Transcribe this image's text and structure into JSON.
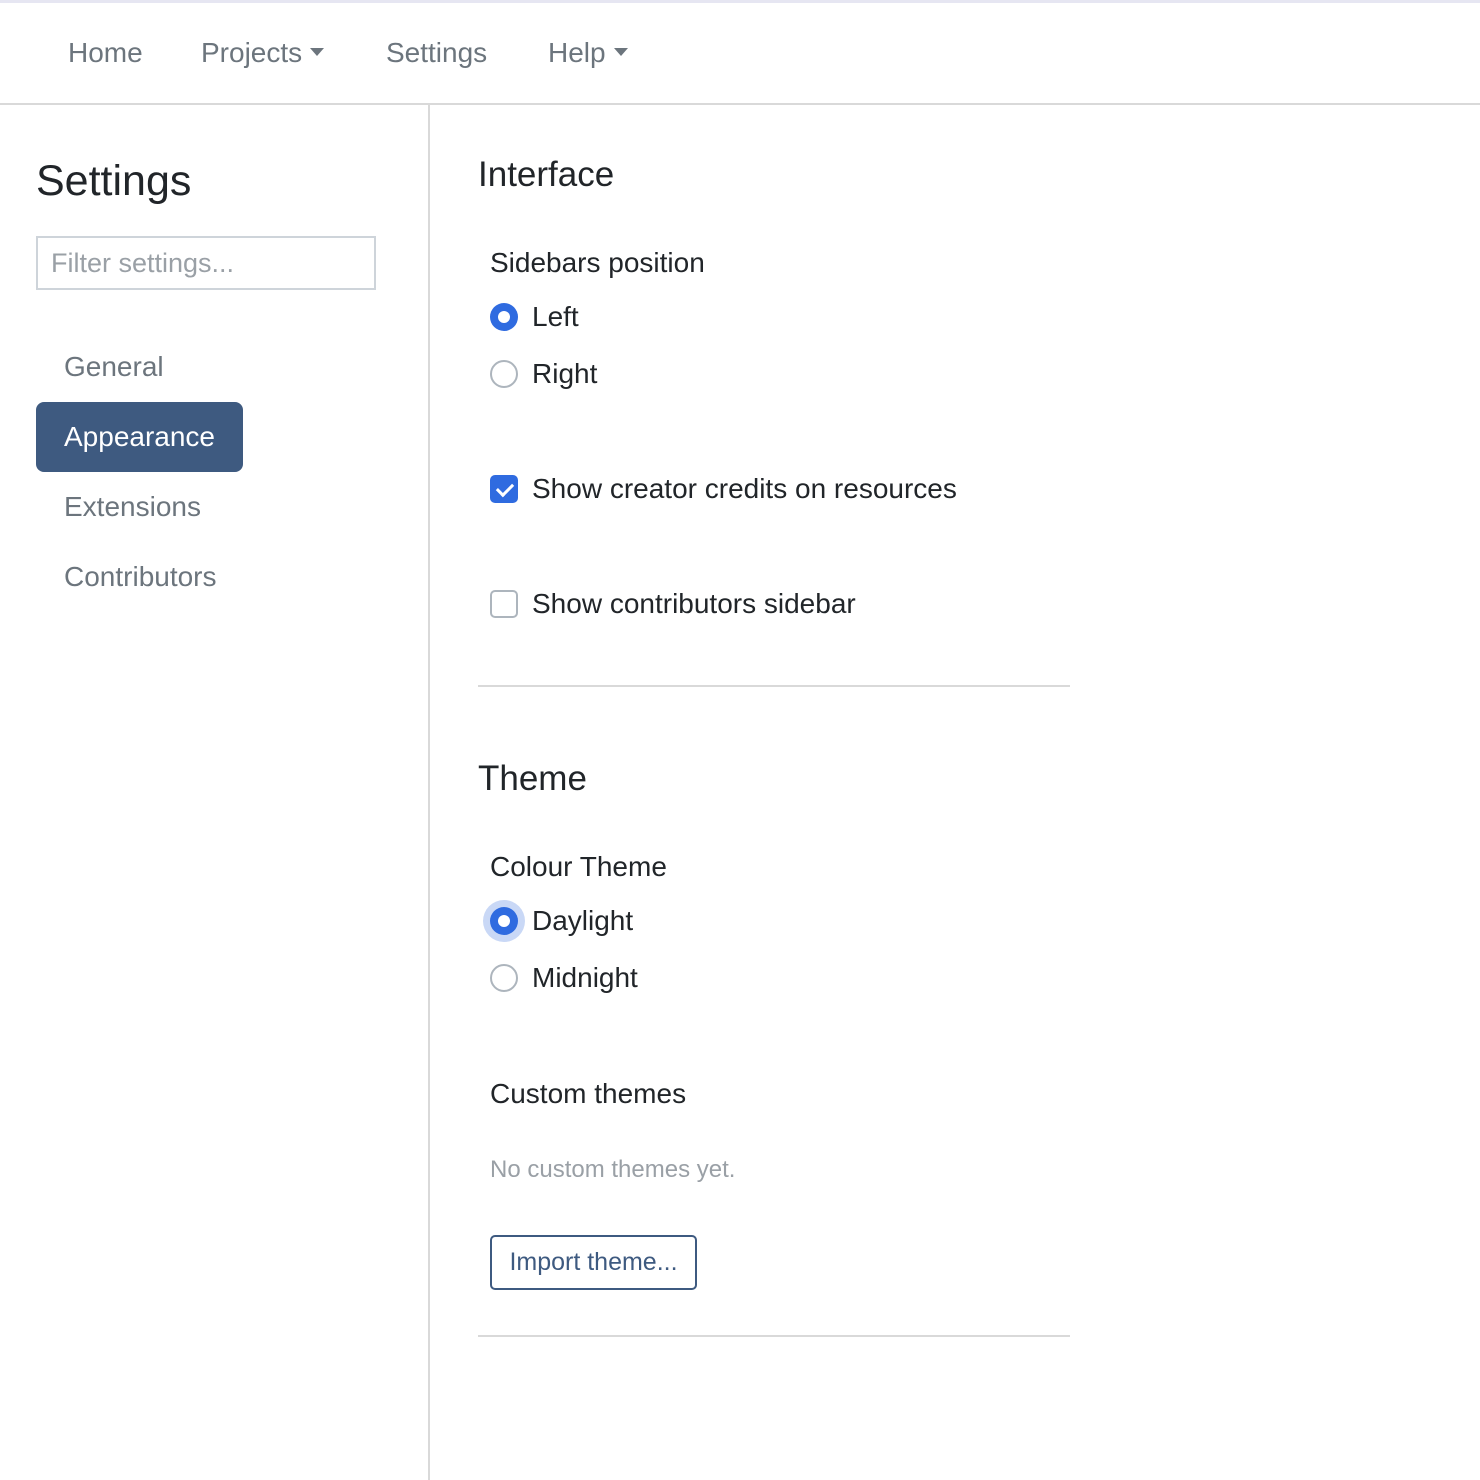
{
  "navbar": {
    "items": [
      {
        "label": "Home",
        "has_dropdown": false
      },
      {
        "label": "Projects",
        "has_dropdown": true
      },
      {
        "label": "Settings",
        "has_dropdown": false
      },
      {
        "label": "Help",
        "has_dropdown": true
      }
    ]
  },
  "sidebar": {
    "title": "Settings",
    "filter_placeholder": "Filter settings...",
    "items": [
      {
        "label": "General",
        "active": false
      },
      {
        "label": "Appearance",
        "active": true
      },
      {
        "label": "Extensions",
        "active": false
      },
      {
        "label": "Contributors",
        "active": false
      }
    ]
  },
  "interface": {
    "title": "Interface",
    "sidebars_position": {
      "label": "Sidebars position",
      "options": [
        {
          "label": "Left",
          "checked": true
        },
        {
          "label": "Right",
          "checked": false
        }
      ]
    },
    "show_creator_credits": {
      "label": "Show creator credits on resources",
      "checked": true
    },
    "show_contributors_sidebar": {
      "label": "Show contributors sidebar",
      "checked": false
    }
  },
  "theme": {
    "title": "Theme",
    "colour_theme": {
      "label": "Colour Theme",
      "options": [
        {
          "label": "Daylight",
          "checked": true,
          "focused": true
        },
        {
          "label": "Midnight",
          "checked": false
        }
      ]
    },
    "custom_themes": {
      "label": "Custom themes",
      "empty_text": "No custom themes yet.",
      "import_label": "Import theme..."
    }
  },
  "colors": {
    "accent": "#2f6be0",
    "active_nav": "#3e5a80",
    "muted_text": "#6c757d"
  }
}
